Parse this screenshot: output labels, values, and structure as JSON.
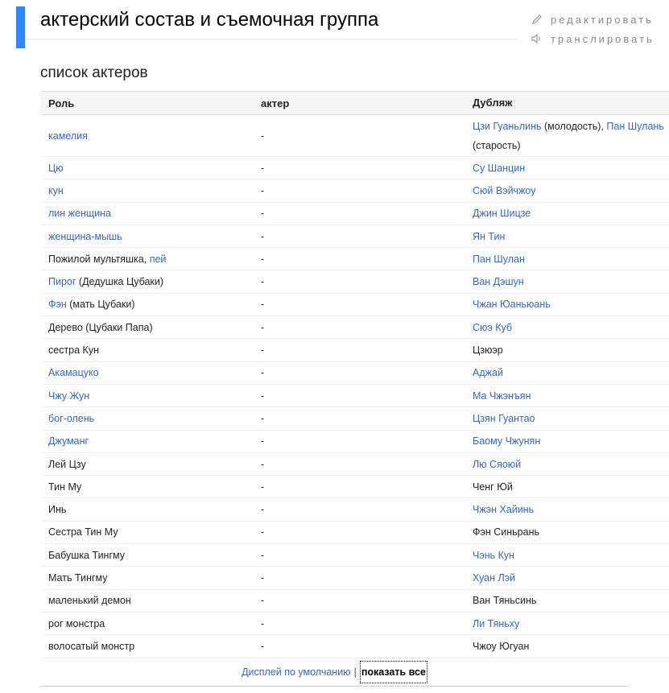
{
  "page_title": "актерский состав и съемочная группа",
  "actions": {
    "edit": "редактировать",
    "translate": "транслировать"
  },
  "section_title": "список актеров",
  "table": {
    "headers": {
      "role": "Роль",
      "actor": "актер",
      "dub": "Дубляж"
    },
    "rows": [
      {
        "role": [
          {
            "t": "камелия",
            "link": true
          }
        ],
        "actor": "-",
        "dub": [
          {
            "t": "Цзи Гуаньлинь",
            "link": true
          },
          {
            "t": " (молодость), ",
            "link": false
          },
          {
            "t": "Пан Шулань",
            "link": true
          },
          {
            "t": " (старость)",
            "link": false
          }
        ],
        "tall": true
      },
      {
        "role": [
          {
            "t": "Цю",
            "link": true
          }
        ],
        "actor": "-",
        "dub": [
          {
            "t": "Су Шанцин",
            "link": true
          }
        ]
      },
      {
        "role": [
          {
            "t": "кун",
            "link": true
          }
        ],
        "actor": "-",
        "dub": [
          {
            "t": "Сюй Вэйчжоу",
            "link": true
          }
        ]
      },
      {
        "role": [
          {
            "t": "лин женщина",
            "link": true
          }
        ],
        "actor": "-",
        "dub": [
          {
            "t": "Джин Шицзе",
            "link": true
          }
        ]
      },
      {
        "role": [
          {
            "t": "женщина-мышь",
            "link": true
          }
        ],
        "actor": "-",
        "dub": [
          {
            "t": "Ян Тин",
            "link": true
          }
        ]
      },
      {
        "role": [
          {
            "t": "Пожилой мультяшка, ",
            "link": false
          },
          {
            "t": "пей",
            "link": true
          }
        ],
        "actor": "-",
        "dub": [
          {
            "t": "Пан Шулан",
            "link": true
          }
        ]
      },
      {
        "role": [
          {
            "t": "Пирог",
            "link": true
          },
          {
            "t": " (Дедушка Цубаки)",
            "link": false
          }
        ],
        "actor": "-",
        "dub": [
          {
            "t": "Ван Дэшун",
            "link": true
          }
        ]
      },
      {
        "role": [
          {
            "t": "Фэн",
            "link": true
          },
          {
            "t": " (мать Цубаки)",
            "link": false
          }
        ],
        "actor": "-",
        "dub": [
          {
            "t": "Чжан Юаньюань",
            "link": true
          }
        ]
      },
      {
        "role": [
          {
            "t": "Дерево (Цубаки Папа)",
            "link": false
          }
        ],
        "actor": "-",
        "dub": [
          {
            "t": "Сюэ Куб",
            "link": true
          }
        ]
      },
      {
        "role": [
          {
            "t": "сестра Кун",
            "link": false
          }
        ],
        "actor": "-",
        "dub": [
          {
            "t": "Цзюэр",
            "link": false
          }
        ]
      },
      {
        "role": [
          {
            "t": "Акамацуко",
            "link": true
          }
        ],
        "actor": "-",
        "dub": [
          {
            "t": "Аджай",
            "link": true
          }
        ]
      },
      {
        "role": [
          {
            "t": "Чжу Жун",
            "link": true
          }
        ],
        "actor": "-",
        "dub": [
          {
            "t": "Ма Чжэнъян",
            "link": true
          }
        ]
      },
      {
        "role": [
          {
            "t": "бог-олень",
            "link": true
          }
        ],
        "actor": "-",
        "dub": [
          {
            "t": "Цзян Гуантао",
            "link": true
          }
        ]
      },
      {
        "role": [
          {
            "t": "Джуманг",
            "link": true
          }
        ],
        "actor": "-",
        "dub": [
          {
            "t": "Баому Чжунян",
            "link": true
          }
        ]
      },
      {
        "role": [
          {
            "t": "Лей Цзу",
            "link": false
          }
        ],
        "actor": "-",
        "dub": [
          {
            "t": "Лю Сяоюй",
            "link": true
          }
        ]
      },
      {
        "role": [
          {
            "t": "Тин Му",
            "link": false
          }
        ],
        "actor": "-",
        "dub": [
          {
            "t": "Ченг Юй",
            "link": false
          }
        ]
      },
      {
        "role": [
          {
            "t": "Инь",
            "link": false
          }
        ],
        "actor": "-",
        "dub": [
          {
            "t": "Чжэн Хайинь",
            "link": true
          }
        ]
      },
      {
        "role": [
          {
            "t": "Сестра Тин Му",
            "link": false
          }
        ],
        "actor": "-",
        "dub": [
          {
            "t": "Фэн Синьрань",
            "link": false
          }
        ]
      },
      {
        "role": [
          {
            "t": "Бабушка Тингму",
            "link": false
          }
        ],
        "actor": "-",
        "dub": [
          {
            "t": "Чэнь Кун",
            "link": true
          }
        ]
      },
      {
        "role": [
          {
            "t": "Мать Тингму",
            "link": false
          }
        ],
        "actor": "-",
        "dub": [
          {
            "t": "Хуан Лэй",
            "link": true
          }
        ]
      },
      {
        "role": [
          {
            "t": "маленький демон",
            "link": false
          }
        ],
        "actor": "-",
        "dub": [
          {
            "t": "Ван Тяньсинь",
            "link": false
          }
        ]
      },
      {
        "role": [
          {
            "t": "рог монстра",
            "link": false
          }
        ],
        "actor": "-",
        "dub": [
          {
            "t": "Ли Тяньху",
            "link": true
          }
        ]
      },
      {
        "role": [
          {
            "t": "волосатый монстр",
            "link": false
          }
        ],
        "actor": "-",
        "dub": [
          {
            "t": "Чжоу Югуан",
            "link": false
          }
        ]
      }
    ]
  },
  "footer": {
    "default_display": "Дисплей по умолчанию",
    "separator": "|",
    "show_all": "показать все"
  }
}
